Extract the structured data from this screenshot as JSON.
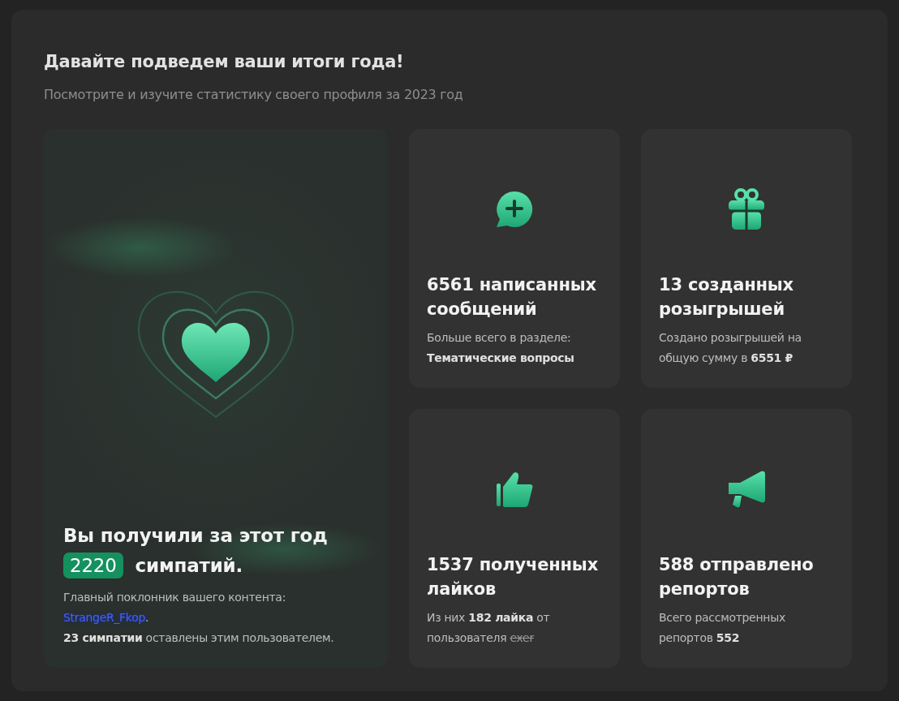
{
  "header": {
    "title": "Давайте подведем ваши итоги года!",
    "subtitle": "Посмотрите и изучите статистику своего профиля за 2023 год"
  },
  "highlight": {
    "title": "Вы получили за этот год",
    "count": "2220",
    "suffix": "симпатий.",
    "fan_text": "Главный поклонник вашего контента:",
    "fan_link": "StrangeR_Fkop",
    "fan_after": ".",
    "note": "**23 симпатии** оставлены этим пользователем."
  },
  "stats": [
    {
      "kind": "messages",
      "title": "6561 написанных сообщений",
      "desc": "Больше всего в разделе: **Тематические вопросы**"
    },
    {
      "kind": "giveaways",
      "title": "13 созданных розыгрышей",
      "desc": "Создано розыгрышей на общую сумму в **6551 ₽**"
    },
    {
      "kind": "likes",
      "title": "1537 полученных лайков",
      "desc": "Из них **182 лайка** от пользователя",
      "struck": "exer"
    },
    {
      "kind": "reports",
      "title": "588 отправлено репортов",
      "desc": "Всего рассмотренных репортов **552**"
    }
  ]
}
